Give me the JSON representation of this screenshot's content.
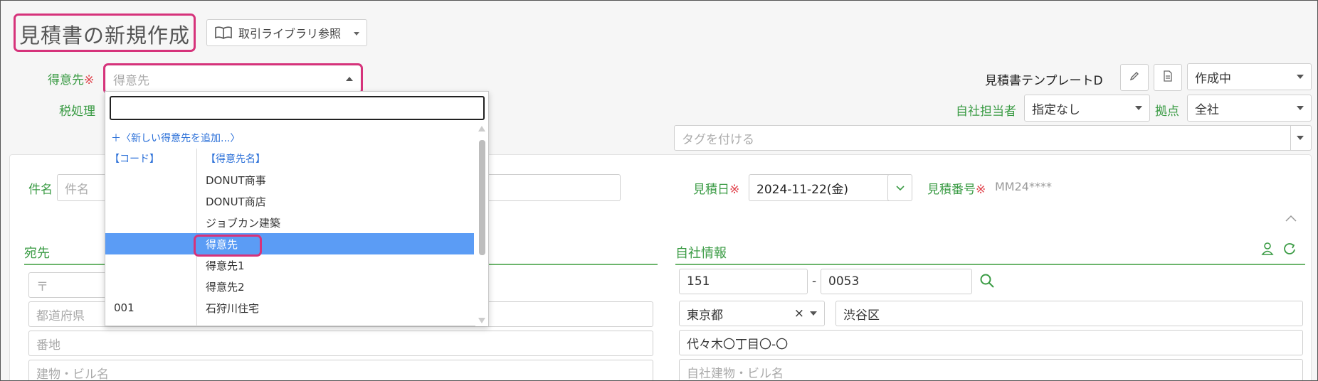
{
  "title": "見積書の新規作成",
  "library_button": "取引ライブラリ参照",
  "customer": {
    "label": "得意先",
    "required_mark": "※",
    "value": "得意先",
    "search_value": ""
  },
  "tax_label": "税処理",
  "template_label": "見積書テンプレートD",
  "status_value": "作成中",
  "staff": {
    "label": "自社担当者",
    "value": "指定なし"
  },
  "branch": {
    "label": "拠点",
    "value": "全社"
  },
  "tags_placeholder": "タグを付ける",
  "subject": {
    "label": "件名",
    "placeholder": "件名"
  },
  "estimate_date": {
    "label": "見積日",
    "required_mark": "※",
    "value": "2024-11-22(金)"
  },
  "estimate_number": {
    "label": "見積番号",
    "required_mark": "※",
    "value": "MM24****"
  },
  "recipient_section": "宛先",
  "company_section": "自社情報",
  "recipient_fields": {
    "postal_placeholder": "〒",
    "prefecture_placeholder": "都道府県",
    "address_placeholder": "番地",
    "building_placeholder": "建物・ビル名"
  },
  "company_fields": {
    "postal1": "151",
    "postal_sep": "-",
    "postal2": "0053",
    "prefecture": "東京都",
    "clear_mark": "×",
    "city": "渋谷区",
    "address": "代々木〇丁目〇-〇",
    "building_placeholder": "自社建物・ビル名"
  },
  "dropdown": {
    "add_new": "＋〈新しい得意先を追加...〉",
    "col_code": "【コード】",
    "col_name": "【得意先名】",
    "rows": [
      {
        "code": "",
        "name": "DONUT商事"
      },
      {
        "code": "",
        "name": "DONUT商店"
      },
      {
        "code": "",
        "name": "ジョブカン建築"
      },
      {
        "code": "",
        "name": "得意先"
      },
      {
        "code": "",
        "name": "得意先1"
      },
      {
        "code": "",
        "name": "得意先2"
      },
      {
        "code": "001",
        "name": "石狩川住宅"
      }
    ],
    "selected_index": 3
  },
  "colors": {
    "accent_green": "#3a9b44",
    "highlight": "#d6337b",
    "selected_row": "#5b9cf5",
    "link_blue": "#2a6fd8"
  }
}
